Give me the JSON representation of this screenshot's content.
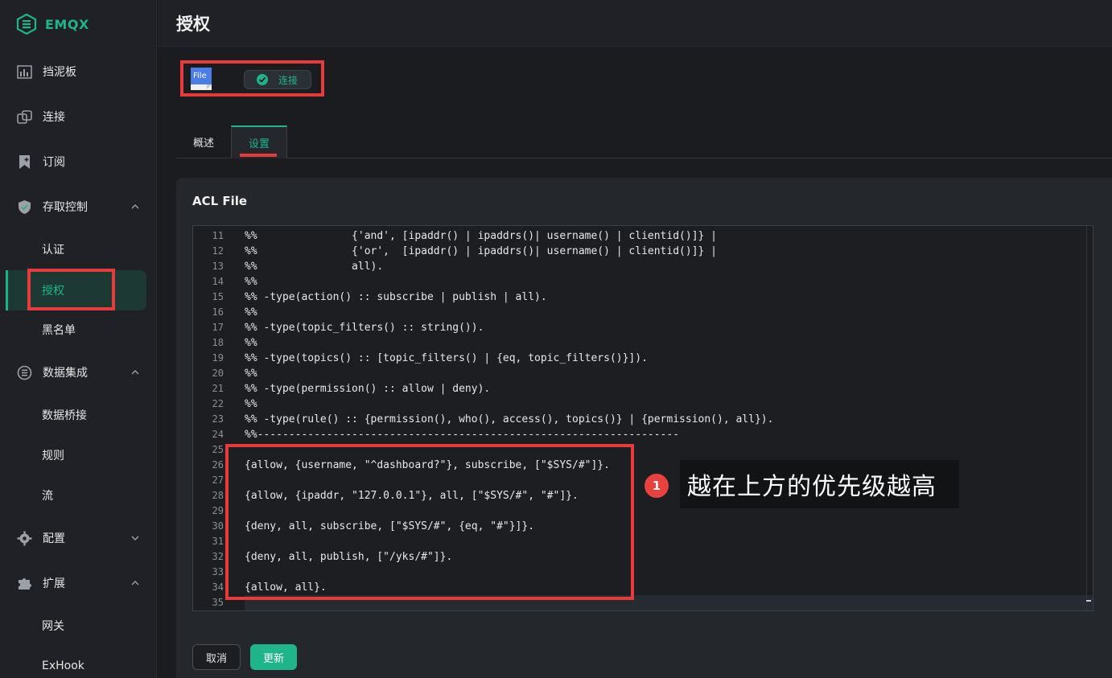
{
  "app": {
    "name": "EMQX"
  },
  "sidebar": {
    "items": [
      {
        "label": "挡泥板",
        "icon": "dashboard-icon"
      },
      {
        "label": "连接",
        "icon": "connections-icon"
      },
      {
        "label": "订阅",
        "icon": "subscriptions-icon"
      },
      {
        "label": "存取控制",
        "icon": "shield-check-icon",
        "expanded": true
      },
      {
        "label": "数据集成",
        "icon": "data-integration-icon",
        "expanded": true
      },
      {
        "label": "配置",
        "icon": "gear-icon",
        "expanded": false
      },
      {
        "label": "扩展",
        "icon": "puzzle-icon",
        "expanded": true
      }
    ],
    "access_sub": [
      "认证",
      "授权",
      "黑名单"
    ],
    "data_sub": [
      "数据桥接",
      "规则",
      "流"
    ],
    "ext_sub": [
      "网关",
      "ExHook"
    ]
  },
  "header": {
    "title": "授权"
  },
  "source": {
    "file_badge": "File",
    "status": "连接"
  },
  "tabs": [
    {
      "label": "概述",
      "active": false
    },
    {
      "label": "设置",
      "active": true
    }
  ],
  "card": {
    "title": "ACL File"
  },
  "editor": {
    "lines": [
      {
        "n": "11",
        "t": "%%               {'and', [ipaddr() | ipaddrs()| username() | clientid()]} |"
      },
      {
        "n": "12",
        "t": "%%               {'or',  [ipaddr() | ipaddrs()| username() | clientid()]} |"
      },
      {
        "n": "13",
        "t": "%%               all)."
      },
      {
        "n": "14",
        "t": "%%"
      },
      {
        "n": "15",
        "t": "%% -type(action() :: subscribe | publish | all)."
      },
      {
        "n": "16",
        "t": "%%"
      },
      {
        "n": "17",
        "t": "%% -type(topic_filters() :: string())."
      },
      {
        "n": "18",
        "t": "%%"
      },
      {
        "n": "19",
        "t": "%% -type(topics() :: [topic_filters() | {eq, topic_filters()}])."
      },
      {
        "n": "20",
        "t": "%%"
      },
      {
        "n": "21",
        "t": "%% -type(permission() :: allow | deny)."
      },
      {
        "n": "22",
        "t": "%%"
      },
      {
        "n": "23",
        "t": "%% -type(rule() :: {permission(), who(), access(), topics()} | {permission(), all})."
      },
      {
        "n": "24",
        "t": "%%-------------------------------------------------------------------"
      },
      {
        "n": "25",
        "t": ""
      },
      {
        "n": "26",
        "t": "{allow, {username, \"^dashboard?\"}, subscribe, [\"$SYS/#\"]}."
      },
      {
        "n": "27",
        "t": ""
      },
      {
        "n": "28",
        "t": "{allow, {ipaddr, \"127.0.0.1\"}, all, [\"$SYS/#\", \"#\"]}."
      },
      {
        "n": "29",
        "t": ""
      },
      {
        "n": "30",
        "t": "{deny, all, subscribe, [\"$SYS/#\", {eq, \"#\"}]}."
      },
      {
        "n": "31",
        "t": ""
      },
      {
        "n": "32",
        "t": "{deny, all, publish, [\"/yks/#\"]}."
      },
      {
        "n": "33",
        "t": ""
      },
      {
        "n": "34",
        "t": "{allow, all}."
      },
      {
        "n": "35",
        "t": ""
      }
    ]
  },
  "buttons": {
    "cancel": "取消",
    "update": "更新"
  },
  "annotation": {
    "number": "1",
    "text": "越在上方的优先级越高"
  },
  "colors": {
    "accent": "#1fb58b",
    "highlight": "#e83a3a",
    "background": "#1b1c1f"
  }
}
